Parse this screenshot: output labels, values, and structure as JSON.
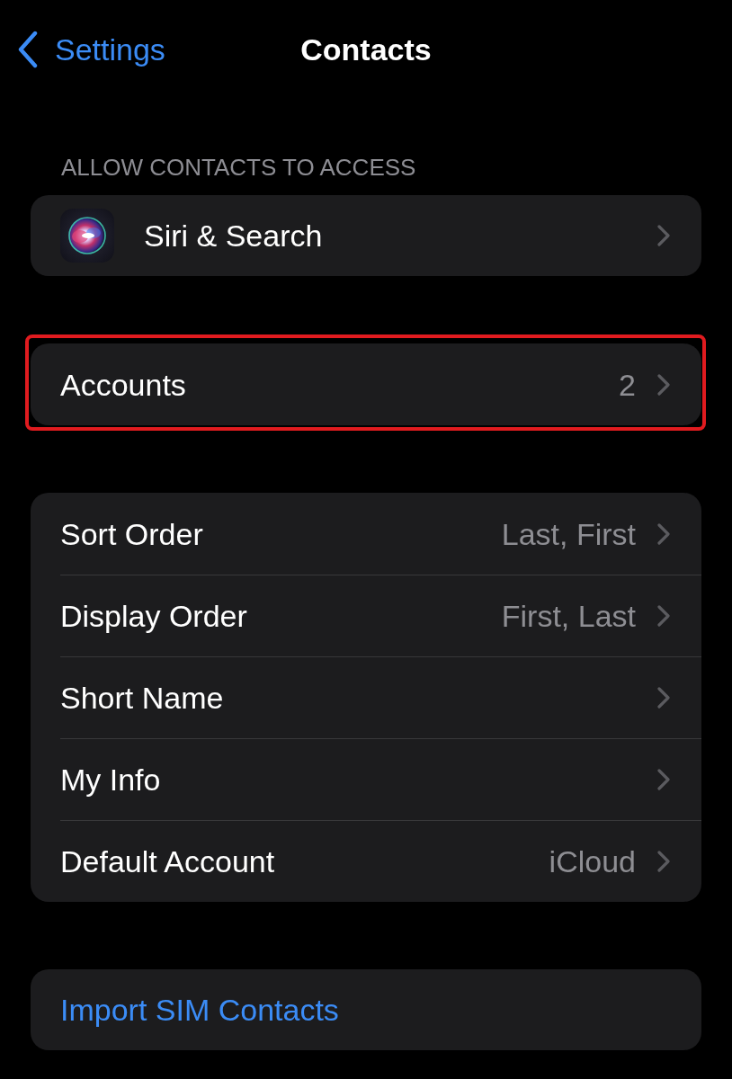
{
  "nav_bar": {
    "back_label": "Settings",
    "title": "Contacts"
  },
  "groups": [
    {
      "header": "ALLOW CONTACTS TO ACCESS",
      "highlighted": false,
      "rows": [
        {
          "kind": "app",
          "label": "Siri & Search"
        }
      ]
    },
    {
      "highlighted": true,
      "rows": [
        {
          "kind": "nav",
          "label": "Accounts",
          "value": "2"
        }
      ]
    },
    {
      "highlighted": false,
      "rows": [
        {
          "kind": "nav",
          "label": "Sort Order",
          "value": "Last, First"
        },
        {
          "kind": "nav",
          "label": "Display Order",
          "value": "First, Last"
        },
        {
          "kind": "nav",
          "label": "Short Name"
        },
        {
          "kind": "nav",
          "label": "My Info"
        },
        {
          "kind": "nav",
          "label": "Default Account",
          "value": "iCloud"
        }
      ]
    },
    {
      "highlighted": false,
      "rows": [
        {
          "kind": "action",
          "label": "Import SIM Contacts"
        }
      ]
    }
  ]
}
